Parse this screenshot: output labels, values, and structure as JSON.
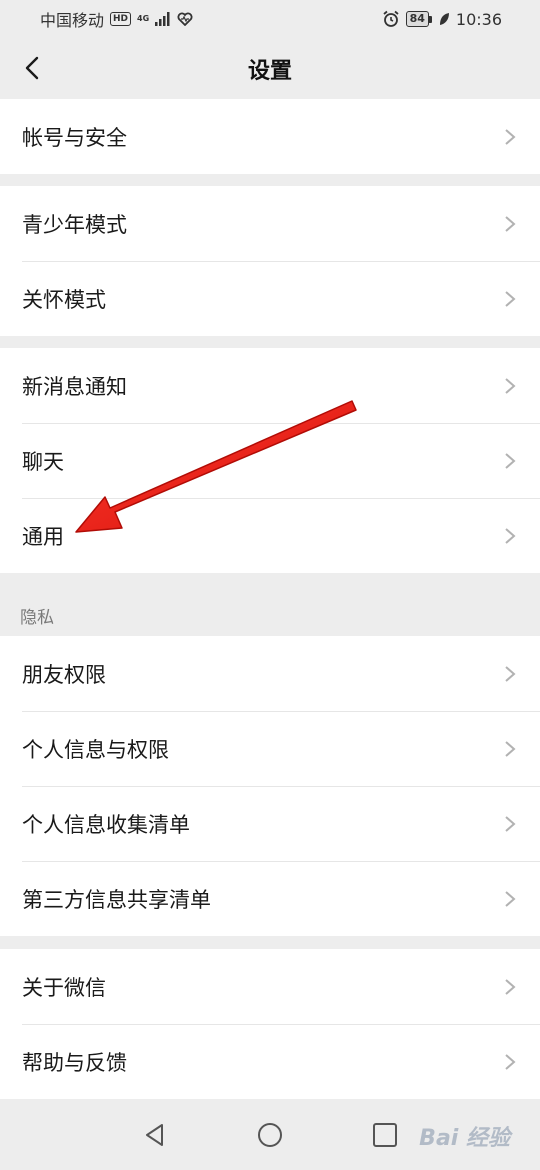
{
  "status_bar": {
    "carrier": "中国移动",
    "hd": "HD",
    "network_top": "4G",
    "network_bottom": "",
    "battery": "84",
    "time": "10:36"
  },
  "header": {
    "title": "设置"
  },
  "groups": [
    {
      "items": [
        {
          "label": "帐号与安全"
        }
      ]
    },
    {
      "items": [
        {
          "label": "青少年模式"
        },
        {
          "label": "关怀模式"
        }
      ]
    },
    {
      "items": [
        {
          "label": "新消息通知"
        },
        {
          "label": "聊天"
        },
        {
          "label": "通用"
        }
      ]
    },
    {
      "section_label": "隐私",
      "items": [
        {
          "label": "朋友权限"
        },
        {
          "label": "个人信息与权限"
        },
        {
          "label": "个人信息收集清单"
        },
        {
          "label": "第三方信息共享清单"
        }
      ]
    },
    {
      "items": [
        {
          "label": "关于微信"
        },
        {
          "label": "帮助与反馈"
        }
      ]
    }
  ],
  "annotation": {
    "color": "#e8180f",
    "points_to": "通用"
  },
  "watermark": "Bai 经验",
  "icons": [
    "back-arrow-icon",
    "chevron-right-icon",
    "back-triangle-icon",
    "home-circle-icon",
    "recent-square-icon",
    "alarm-icon",
    "heart-icon",
    "leaf-icon",
    "signal-icon"
  ]
}
